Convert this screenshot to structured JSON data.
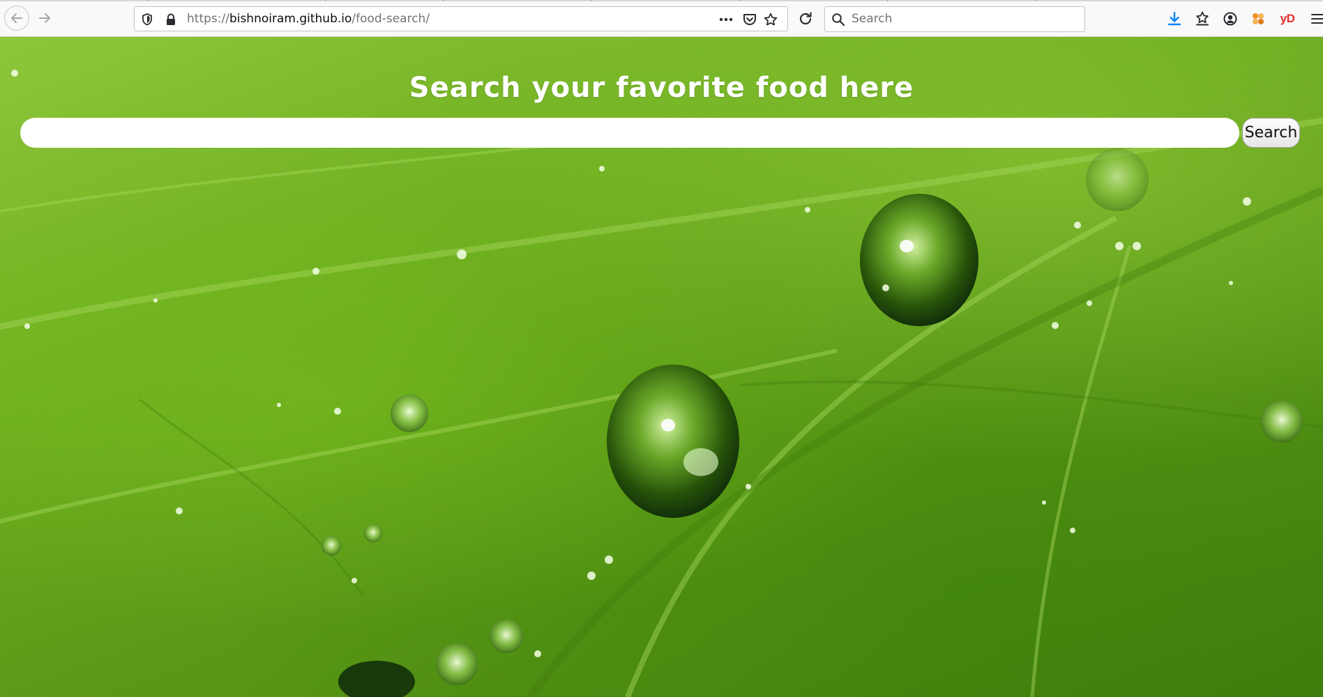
{
  "browser": {
    "url_scheme": "https://",
    "url_host": "bishnoiram.github.io",
    "url_path": "/food-search/",
    "search_placeholder": "Search",
    "extension_label": "yD",
    "icons": {
      "back": "arrow-left-icon",
      "forward": "arrow-right-icon",
      "tracking": "shield-icon",
      "lock": "lock-icon",
      "page_actions": "more-horizontal-icon",
      "pocket": "pocket-icon",
      "bookmark": "star-icon",
      "reload": "reload-icon",
      "search": "search-icon",
      "downloads": "download-icon",
      "library": "library-star-icon",
      "account": "account-icon",
      "extension_orange": "puzzle-icon",
      "menu": "hamburger-menu-icon"
    },
    "colors": {
      "download_accent": "#0a84ff",
      "extension_red": "#e0302c",
      "extension_orange": "#f0902a"
    }
  },
  "page": {
    "title": "Search your favorite food here",
    "search": {
      "value": "",
      "placeholder": ""
    },
    "search_button_label": "Search",
    "background": "green-leaf-with-water-droplets"
  }
}
